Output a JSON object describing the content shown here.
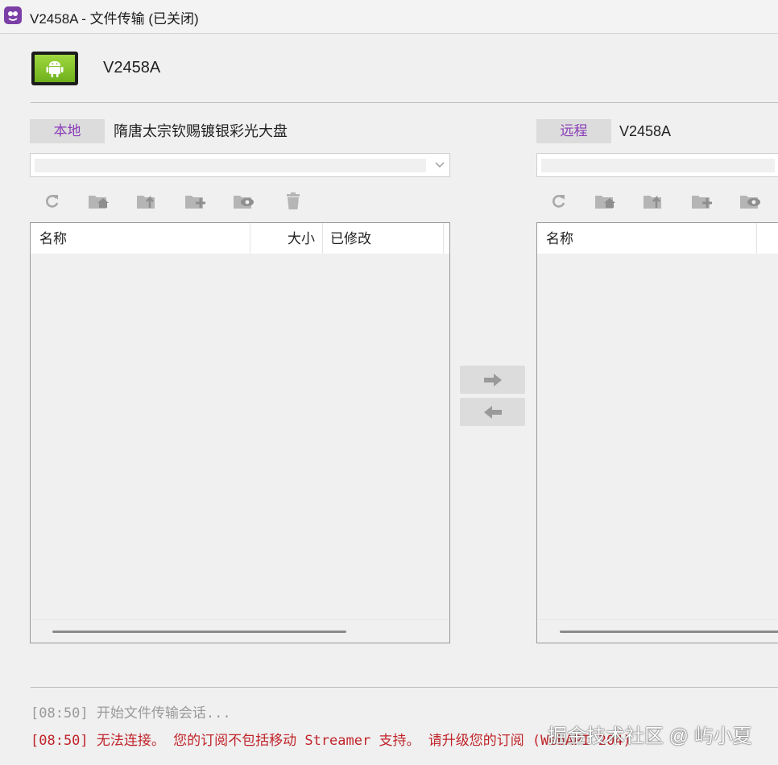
{
  "window": {
    "title": "V2458A - 文件传输 (已关闭)",
    "app_icon": "teamviewer-logo-icon"
  },
  "device": {
    "name": "V2458A",
    "icon": "android-device-icon"
  },
  "local": {
    "label": "本地",
    "path": "隋唐太宗钦赐镀银彩光大盘",
    "combo_value": "",
    "columns": [
      "名称",
      "大小",
      "已修改"
    ]
  },
  "remote": {
    "label": "远程",
    "path": "V2458A",
    "combo_value": "",
    "columns": [
      "名称"
    ]
  },
  "toolbar_icons": [
    "refresh-icon",
    "home-folder-icon",
    "parent-folder-icon",
    "new-folder-icon",
    "show-hidden-icon",
    "delete-icon"
  ],
  "transfer": {
    "send_icon": "arrow-right-icon",
    "receive_icon": "arrow-left-icon"
  },
  "log": {
    "info": "[08:50] 开始文件传输会话...",
    "error": "[08:50] 无法连接。 您的订阅不包括移动 Streamer 支持。 请升级您的订阅 (WebAPI 204)"
  },
  "watermark": "掘金技术社区 @ 屿小夏",
  "colors": {
    "accent": "#8a3cb8",
    "error": "#c0242a",
    "android": "#8cc63f"
  }
}
